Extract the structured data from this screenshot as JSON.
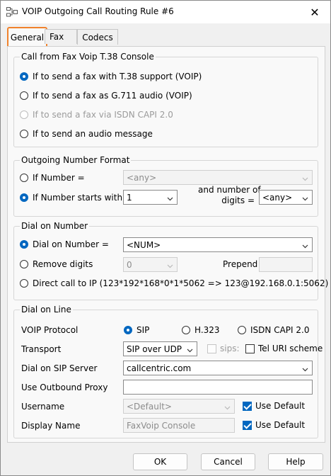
{
  "window": {
    "title": "VOIP Outgoing Call Routing Rule #6",
    "close_glyph": "✕"
  },
  "tabs": [
    {
      "label": "General"
    },
    {
      "label": "Fax"
    },
    {
      "label": "Codecs"
    }
  ],
  "call_from": {
    "title": "Call from Fax Voip T.38 Console",
    "options": [
      {
        "label": "If to send a fax with T.38 support (VOIP)",
        "checked": true
      },
      {
        "label": "If to send a fax as G.711 audio (VOIP)",
        "checked": false
      },
      {
        "label": "If to send a fax via ISDN CAPI 2.0",
        "checked": false,
        "disabled": true
      },
      {
        "label": "If to send an audio message",
        "checked": false
      }
    ]
  },
  "number_format": {
    "title": "Outgoing Number Format",
    "if_number_label": "If Number =",
    "if_number_value": "<any>",
    "starts_with_label": "If Number starts with",
    "starts_with_value": "1",
    "digits_label_1": "and number of",
    "digits_label_2": "digits =",
    "digits_value": "<any>"
  },
  "dial_on_number": {
    "title": "Dial on Number",
    "dial_label": "Dial on Number =",
    "dial_value": "<NUM>",
    "remove_label": "Remove digits",
    "remove_value": "0",
    "prepend_label": "Prepend",
    "prepend_value": "",
    "direct_label": "Direct call to IP (123*192*168*0*1*5062 => 123@192.168.0.1:5062)"
  },
  "dial_on_line": {
    "title": "Dial on Line",
    "protocol_label": "VOIP Protocol",
    "protocol_options": [
      {
        "label": "SIP"
      },
      {
        "label": "H.323"
      },
      {
        "label": "ISDN CAPI 2.0"
      }
    ],
    "transport_label": "Transport",
    "transport_value": "SIP over UDP",
    "sips_label": "sips:",
    "tel_uri_label": "Tel URI scheme",
    "sip_server_label": "Dial on SIP Server",
    "sip_server_value": "callcentric.com",
    "proxy_label": "Use Outbound Proxy",
    "proxy_value": "",
    "username_label": "Username",
    "username_value": "<Default>",
    "use_default_label": "Use Default",
    "display_name_label": "Display Name",
    "display_name_value": "FaxVoip Console"
  },
  "buttons": {
    "ok": "OK",
    "cancel": "Cancel",
    "help": "Help"
  },
  "colors": {
    "accent": "#0067c0",
    "tab_highlight": "#f0822c"
  }
}
